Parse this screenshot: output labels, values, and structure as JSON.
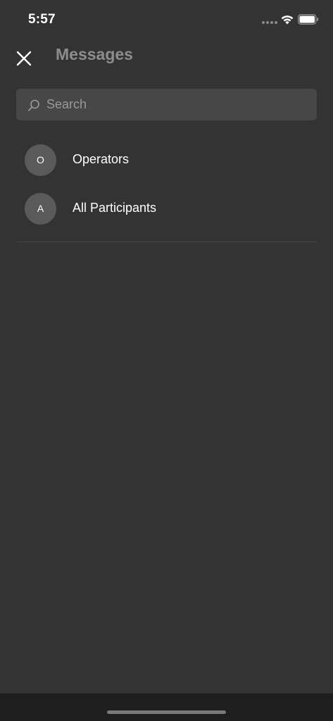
{
  "status_bar": {
    "time": "5:57",
    "signal_icon": "cellular-signal-icon",
    "wifi_icon": "wifi-icon",
    "battery_icon": "battery-icon"
  },
  "header": {
    "close_icon": "close-icon",
    "title": "Messages"
  },
  "search": {
    "placeholder": "Search",
    "value": "",
    "icon": "search-icon"
  },
  "conversations": [
    {
      "initial": "O",
      "name": "Operators"
    },
    {
      "initial": "A",
      "name": "All Participants"
    }
  ],
  "colors": {
    "background": "#333333",
    "title": "#8d8d8d",
    "search_background": "#474747",
    "avatar_background": "#5a5a5a",
    "text": "#ffffff"
  }
}
